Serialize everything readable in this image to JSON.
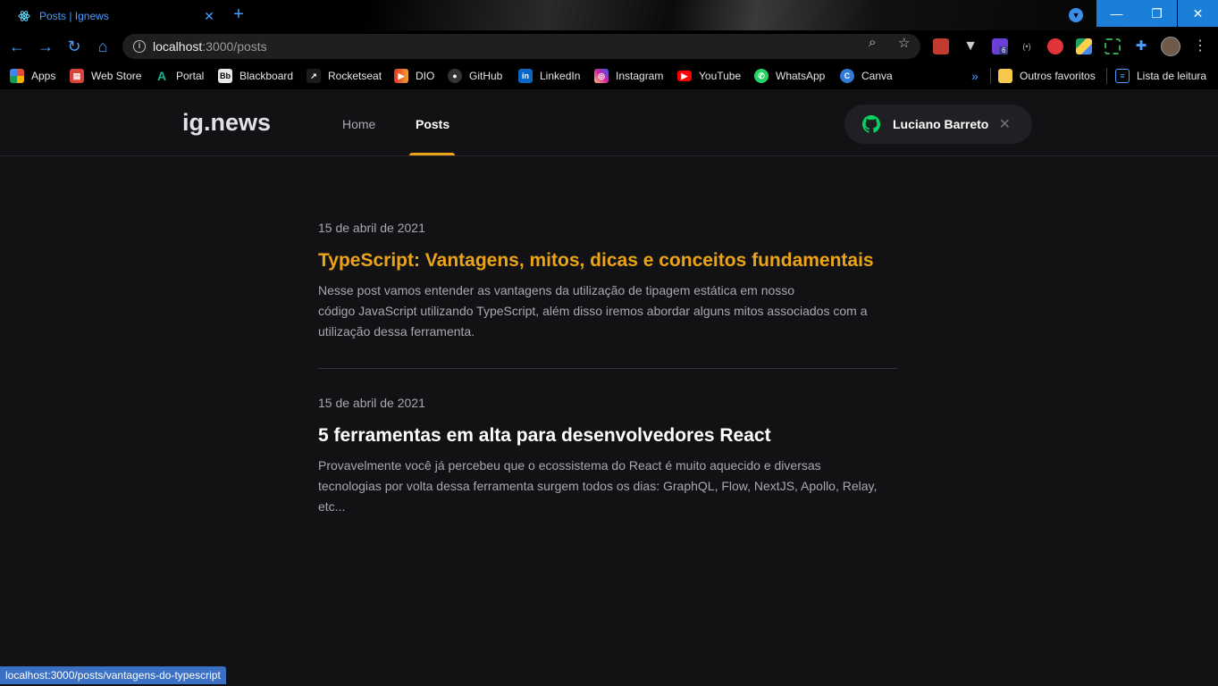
{
  "browser": {
    "tab_title": "Posts | Ignews",
    "url_host": "localhost",
    "url_path": ":3000/posts",
    "extension_badge": "6",
    "bookmarks": [
      {
        "label": "Apps",
        "icon": "apps-grid-icon",
        "color": "#e04a3a"
      },
      {
        "label": "Web Store",
        "icon": "webstore-icon",
        "color": "#d9423a"
      },
      {
        "label": "Portal",
        "icon": "portal-icon",
        "color": "#19b394"
      },
      {
        "label": "Blackboard",
        "icon": "blackboard-icon",
        "color": "#222222"
      },
      {
        "label": "Rocketseat",
        "icon": "rocketseat-icon",
        "color": "#1b1b1b"
      },
      {
        "label": "DIO",
        "icon": "dio-icon",
        "color": "#e6342a"
      },
      {
        "label": "GitHub",
        "icon": "github-icon",
        "color": "#333333"
      },
      {
        "label": "LinkedIn",
        "icon": "linkedin-icon",
        "color": "#0a66c2"
      },
      {
        "label": "Instagram",
        "icon": "instagram-icon",
        "color": "#d6249f"
      },
      {
        "label": "YouTube",
        "icon": "youtube-icon",
        "color": "#ff0000"
      },
      {
        "label": "WhatsApp",
        "icon": "whatsapp-icon",
        "color": "#25d366"
      },
      {
        "label": "Canva",
        "icon": "canva-icon",
        "color": "#2f7bd9"
      }
    ],
    "other_bookmarks": "Outros favoritos",
    "reading_list": "Lista de leitura",
    "status_url": "localhost:3000/posts/vantagens-do-typescript"
  },
  "site": {
    "logo": "ig.news",
    "nav": {
      "home": "Home",
      "posts": "Posts"
    },
    "user_name": "Luciano Barreto",
    "accent_color": "#eba417"
  },
  "posts": [
    {
      "date": "15 de abril de 2021",
      "title": "TypeScript: Vantagens, mitos, dicas e conceitos fundamentais",
      "excerpt_lines": [
        "Nesse post vamos entender as vantagens da utilização de tipagem estática em nosso",
        "código JavaScript utilizando TypeScript, além disso iremos abordar alguns mitos associados com a",
        "utilização dessa ferramenta."
      ]
    },
    {
      "date": "15 de abril de 2021",
      "title": "5 ferramentas em alta para desenvolvedores React",
      "excerpt_lines": [
        "Provavelmente você já percebeu que o ecossistema do React é muito aquecido e diversas",
        "tecnologias por volta dessa ferramenta surgem todos os dias: GraphQL, Flow, NextJS, Apollo, Relay,",
        "etc..."
      ]
    }
  ]
}
